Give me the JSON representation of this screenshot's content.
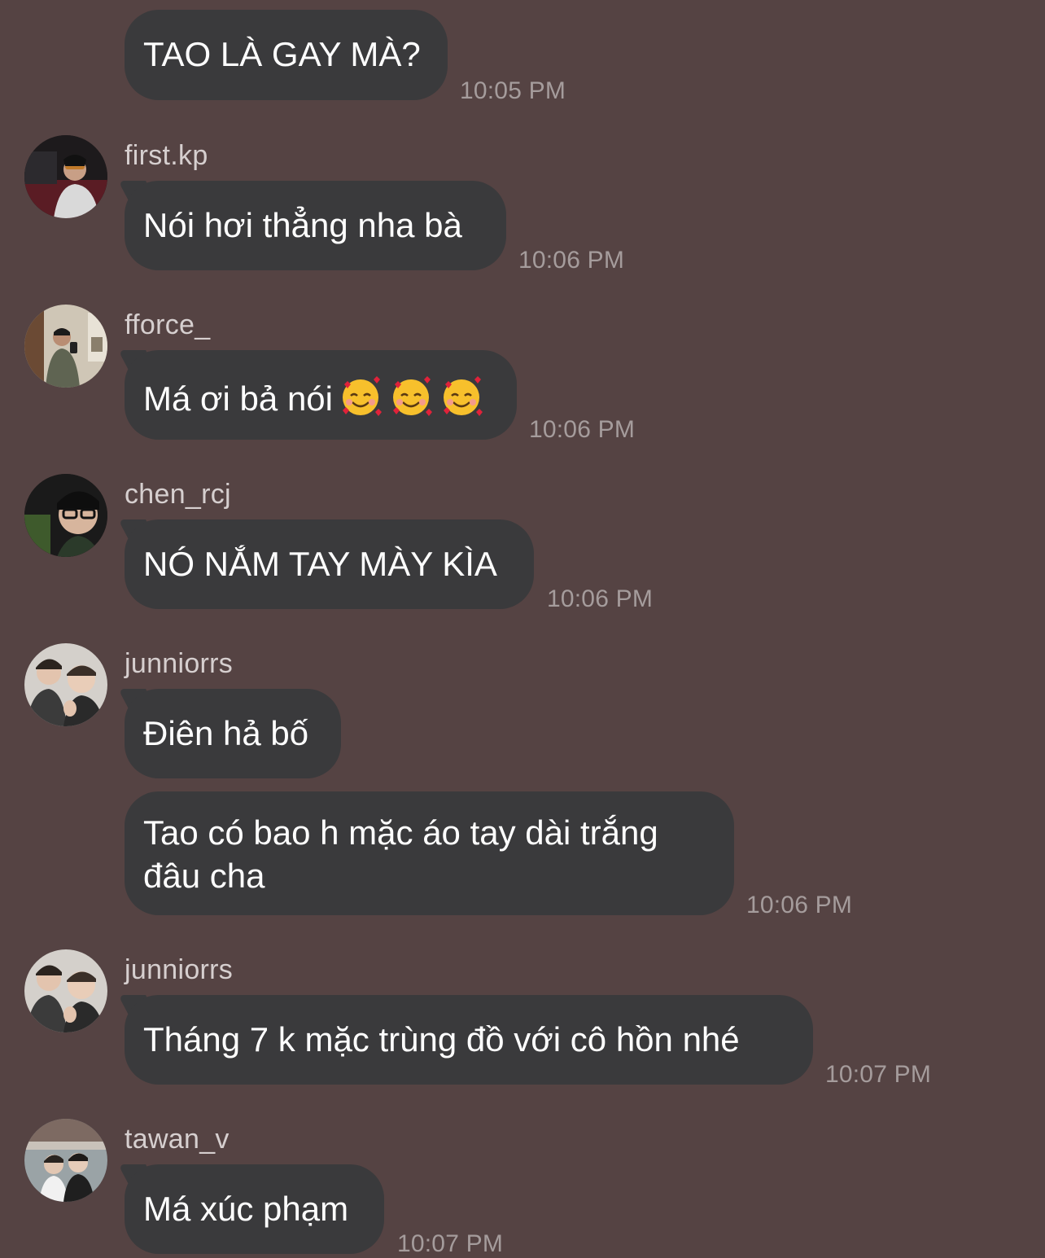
{
  "messages": [
    {
      "sender": "",
      "text": "TAO LÀ GAY MÀ?",
      "time": "10:05 PM"
    },
    {
      "sender": "first.kp",
      "text": "Nói hơi thẳng nha bà",
      "time": "10:06 PM",
      "avatar": "avatar-first-kp"
    },
    {
      "sender": "fforce_",
      "text": "Má ơi bả nói",
      "emoji": [
        "smiling-face-with-hearts-emoji",
        "smiling-face-with-hearts-emoji",
        "smiling-face-with-hearts-emoji"
      ],
      "time": "10:06 PM",
      "avatar": "avatar-fforce"
    },
    {
      "sender": "chen_rcj",
      "text": "NÓ NẮM TAY MÀY KÌA",
      "time": "10:06 PM",
      "avatar": "avatar-chen-rcj"
    },
    {
      "sender": "junniorrs",
      "text": "Điên hả bố",
      "time": "",
      "avatar": "avatar-junniorrs"
    },
    {
      "sender": "",
      "text": "Tao có bao h mặc áo tay dài trắng đâu cha",
      "time": "10:06 PM"
    },
    {
      "sender": "junniorrs",
      "text": "Tháng 7 k mặc trùng đồ với cô hồn nhé",
      "time": "10:07 PM",
      "avatar": "avatar-junniorrs"
    },
    {
      "sender": "tawan_v",
      "text": "Má xúc phạm",
      "time": "10:07 PM",
      "avatar": "avatar-tawan-v"
    }
  ],
  "colors": {
    "background": "#554343",
    "bubble": "#3a3a3c",
    "text": "#ffffff",
    "sender": "#d6cfcf",
    "time": "#a59c9c"
  }
}
